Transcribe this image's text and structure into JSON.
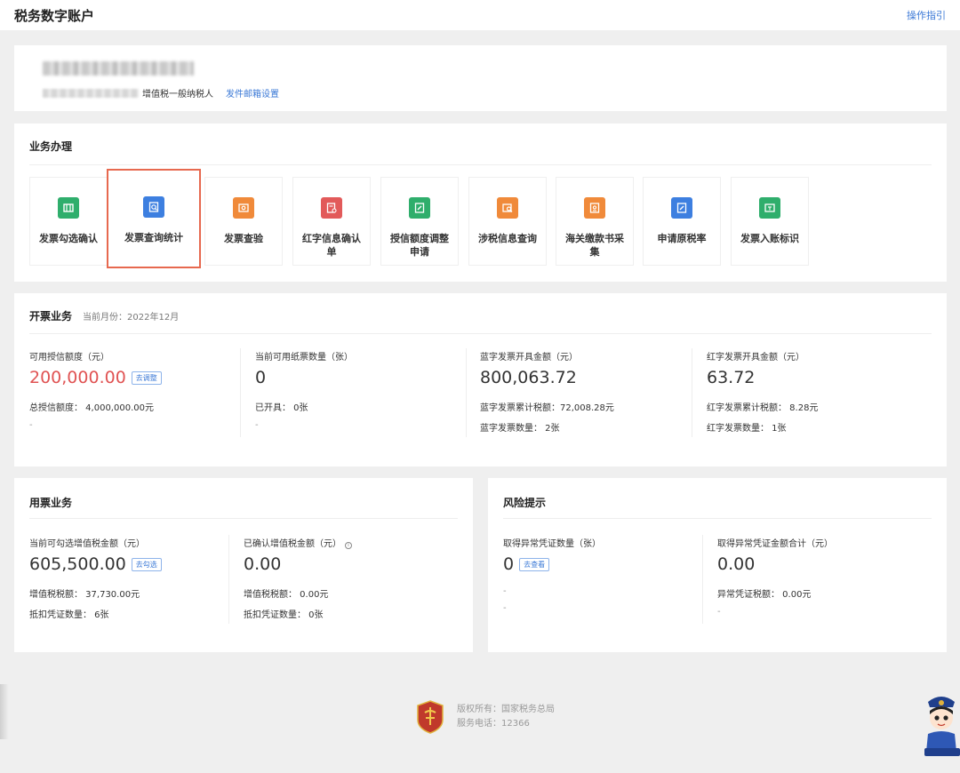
{
  "header": {
    "title": "税务数字账户",
    "help_link": "操作指引"
  },
  "account": {
    "taxpayer_type": "增值税一般纳税人",
    "email_link": "发件邮箱设置"
  },
  "business": {
    "title": "业务办理",
    "tiles": [
      {
        "label": "发票勾选确认",
        "icon": "invoice-check-icon",
        "color": "#2fae6c"
      },
      {
        "label": "发票查询统计",
        "icon": "invoice-search-icon",
        "color": "#3d7fe0"
      },
      {
        "label": "发票查验",
        "icon": "invoice-verify-icon",
        "color": "#f08a3a"
      },
      {
        "label": "红字信息确认单",
        "icon": "red-invoice-icon",
        "color": "#e25a5a"
      },
      {
        "label": "授信额度调整申请",
        "icon": "credit-adjust-icon",
        "color": "#2fae6c"
      },
      {
        "label": "涉税信息查询",
        "icon": "tax-info-icon",
        "color": "#f08a3a"
      },
      {
        "label": "海关缴款书采集",
        "icon": "customs-icon",
        "color": "#f08a3a"
      },
      {
        "label": "申请原税率",
        "icon": "tax-rate-icon",
        "color": "#3d7fe0"
      },
      {
        "label": "发票入账标识",
        "icon": "invoice-account-icon",
        "color": "#2fae6c"
      }
    ]
  },
  "invoicing": {
    "title": "开票业务",
    "month_label": "当前月份：2022年12月",
    "cols": [
      {
        "label": "可用授信额度（元）",
        "value": "200,000.00",
        "tag": "去调整",
        "sub1": "总授信额度：  4,000,000.00元",
        "sub2": "-"
      },
      {
        "label": "当前可用纸票数量（张）",
        "value": "0",
        "sub1": "已开具：  0张",
        "sub2": "-"
      },
      {
        "label": "蓝字发票开具金额（元）",
        "value": "800,063.72",
        "sub1": "蓝字发票累计税额：72,008.28元",
        "sub2": "蓝字发票数量：  2张"
      },
      {
        "label": "红字发票开具金额（元）",
        "value": "63.72",
        "sub1": "红字发票累计税额：  8.28元",
        "sub2": "红字发票数量：  1张"
      }
    ]
  },
  "usage": {
    "title": "用票业务",
    "cols": [
      {
        "label": "当前可勾选增值税金额（元）",
        "value": "605,500.00",
        "tag": "去勾选",
        "sub1": "增值税税额：  37,730.00元",
        "sub2": "抵扣凭证数量：  6张"
      },
      {
        "label": "已确认增值税金额（元）",
        "value": "0.00",
        "sub1": "增值税税额：  0.00元",
        "sub2": "抵扣凭证数量：  0张"
      }
    ]
  },
  "risk": {
    "title": "风险提示",
    "cols": [
      {
        "label": "取得异常凭证数量（张）",
        "value": "0",
        "tag": "去查看",
        "sub1": "-",
        "sub2": "-"
      },
      {
        "label": "取得异常凭证金额合计（元）",
        "value": "0.00",
        "sub1": "异常凭证税额：  0.00元",
        "sub2": "-"
      }
    ]
  },
  "footer": {
    "copyright": "版权所有：国家税务总局",
    "phone": "服务电话：12366"
  }
}
